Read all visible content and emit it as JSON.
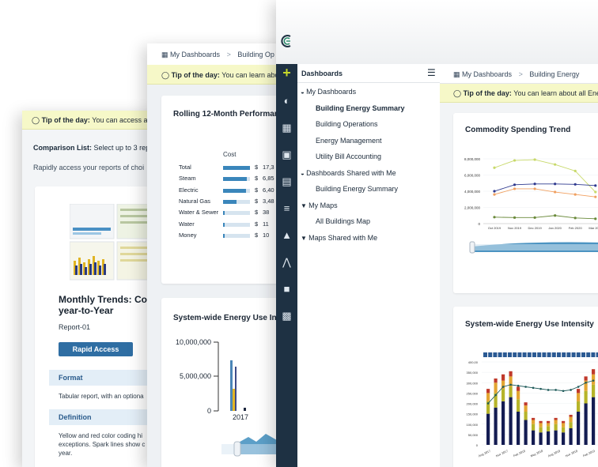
{
  "window_a": {
    "tip_label": "Tip of the day:",
    "tip_text": "You can access a PC",
    "comparison_label": "Comparison List:",
    "comparison_text": "Select up to 3 rep",
    "intro_text": "Rapidly access your reports of choi",
    "report_title_line1": "Monthly Trends: Cor",
    "report_title_line2": "year-to-Year",
    "report_id": "Report-01",
    "rapid_access_label": "Rapid Access",
    "format_heading": "Format",
    "format_text": "Tabular report, with an optiona",
    "definition_heading": "Definition",
    "definition_line1": "Yellow and red color coding hi",
    "definition_line2": "exceptions. Spark lines show c",
    "definition_line3": "year."
  },
  "window_b": {
    "breadcrumb": [
      "My Dashboards",
      "Building Op"
    ],
    "tip_label": "Tip of the day:",
    "tip_text": "You can learn about al",
    "rolling_title": "Rolling 12-Month Performan",
    "cost_header": "Cost",
    "rows": [
      {
        "label": "Total",
        "value": "17,3",
        "fraction": 1.0
      },
      {
        "label": "Steam",
        "value": "6,85",
        "fraction": 0.88
      },
      {
        "label": "Electric",
        "value": "6,40",
        "fraction": 0.85
      },
      {
        "label": "Natural Gas",
        "value": "3,48",
        "fraction": 0.5
      },
      {
        "label": "Water & Sewer",
        "value": "38",
        "fraction": 0.06
      },
      {
        "label": "Water",
        "value": "11",
        "fraction": 0.04
      },
      {
        "label": "Money",
        "value": "10",
        "fraction": 0.03
      }
    ],
    "currency": "$",
    "eui_title": "System-wide Energy Use Int",
    "eui_chart": {
      "y_ticks": [
        "10,000,000",
        "5,000,000",
        "0"
      ],
      "x_tick": "2017"
    }
  },
  "window_c": {
    "nav_header": "Dashboards",
    "nav_items": [
      {
        "label": "My Dashboards",
        "level": 0,
        "icon": "gauge-icon",
        "bold": false
      },
      {
        "label": "Building Energy Summary",
        "level": 1,
        "bold": true
      },
      {
        "label": "Building Operations",
        "level": 1,
        "bold": false
      },
      {
        "label": "Energy Management",
        "level": 1,
        "bold": false
      },
      {
        "label": "Utility Bill Accounting",
        "level": 1,
        "bold": false
      },
      {
        "label": "Dashboards Shared with Me",
        "level": 0,
        "icon": "gauge-icon",
        "bold": false
      },
      {
        "label": "Building Energy Summary",
        "level": 1,
        "bold": false
      },
      {
        "label": "My Maps",
        "level": 0,
        "icon": "map-pin-icon",
        "bold": false
      },
      {
        "label": "All Buildings Map",
        "level": 1,
        "bold": false
      },
      {
        "label": "Maps Shared with Me",
        "level": 0,
        "icon": "map-pin-icon",
        "bold": false
      }
    ],
    "breadcrumb": [
      "My Dashboards",
      "Building Energy"
    ],
    "tip_label": "Tip of the day:",
    "tip_text": "You can learn about all EnergyCAP",
    "commodity_title": "Commodity Spending Trend",
    "eui_title": "System-wide Energy Use Intensity",
    "sidebar_icons": [
      "gauge-icon",
      "buildings-icon",
      "calculator-icon",
      "meter-icon",
      "list-icon",
      "hierarchy-icon",
      "chart-icon",
      "factory-icon",
      "report-icon"
    ],
    "accent": "#c6d82b",
    "sidebar_color": "#1e3143"
  },
  "chart_data": [
    {
      "type": "line",
      "title": "Commodity Spending Trend",
      "x": [
        "Oct 2019",
        "Nov 2019",
        "Dec 2019",
        "Jan 2020",
        "Feb 2020",
        "Mar 2020"
      ],
      "ylim": [
        0,
        8000000
      ],
      "y_ticks": [
        "8,000,000",
        "6,000,000",
        "4,000,000",
        "2,000,000",
        "0"
      ],
      "series": [
        {
          "color": "#c8d96a",
          "values": [
            6900000,
            7800000,
            7900000,
            7300000,
            6500000,
            3900000
          ]
        },
        {
          "color": "#2f3a8f",
          "values": [
            4000000,
            4800000,
            4900000,
            4900000,
            4850000,
            4700000
          ]
        },
        {
          "color": "#f0a060",
          "values": [
            3600000,
            4300000,
            4300000,
            3900000,
            3600000,
            3300000
          ]
        },
        {
          "color": "#6a8a3a",
          "values": [
            800000,
            750000,
            750000,
            1000000,
            700000,
            600000
          ]
        }
      ]
    },
    {
      "type": "bar",
      "title": "System-wide Energy Use Intensity",
      "y_ticks": [
        "400,00",
        "350,000",
        "300,000",
        "250,000",
        "200,000",
        "150,000",
        "100,000",
        "50,000",
        "0"
      ],
      "x_ticks": [
        "Aug 2017",
        "Nov 2017",
        "Feb 2018",
        "May 2018",
        "Aug 2018",
        "Nov 2018",
        "Feb 2019"
      ],
      "ylim": [
        0,
        400000
      ],
      "stacks": [
        [
          150000,
          60000,
          40000,
          20000
        ],
        [
          180000,
          70000,
          50000,
          20000
        ],
        [
          210000,
          60000,
          40000,
          30000
        ],
        [
          230000,
          50000,
          50000,
          25000
        ],
        [
          160000,
          60000,
          40000,
          20000
        ],
        [
          120000,
          40000,
          30000,
          15000
        ],
        [
          70000,
          30000,
          20000,
          10000
        ],
        [
          60000,
          25000,
          20000,
          10000
        ],
        [
          65000,
          25000,
          15000,
          10000
        ],
        [
          70000,
          30000,
          20000,
          10000
        ],
        [
          60000,
          25000,
          20000,
          10000
        ],
        [
          80000,
          30000,
          25000,
          10000
        ],
        [
          160000,
          50000,
          40000,
          20000
        ],
        [
          200000,
          60000,
          50000,
          20000
        ],
        [
          230000,
          60000,
          50000,
          25000
        ]
      ],
      "line": [
        200000,
        240000,
        280000,
        290000,
        285000,
        280000,
        275000,
        270000,
        265000,
        265000,
        260000,
        265000,
        280000,
        300000,
        310000
      ]
    }
  ]
}
